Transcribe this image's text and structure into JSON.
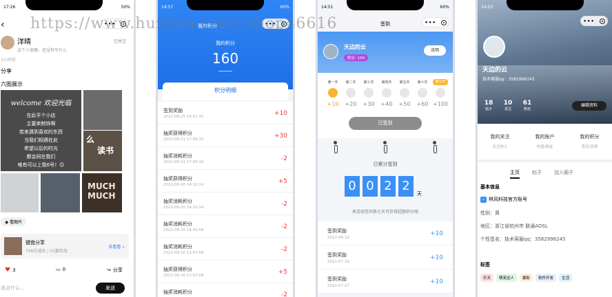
{
  "watermark": "https://www.huzhan.com/ishop46616",
  "phone1": {
    "status_time": "17:26",
    "status_batt": "50%",
    "header_title": "帖子详情",
    "author": "洋晴",
    "signature": "这个人很懒，还没有写什么",
    "follow": "已关注",
    "time": "3小时前",
    "share_heading": "分享",
    "six_heading": "六图展示",
    "image_head": "welcome 欢迎光临",
    "image_lines": [
      "在此平个小店",
      "主要卖制饰啊",
      "若来遇到喜欢的东西",
      "当我们相遇在此",
      "希望以后的时光",
      "都会同在我们",
      "唯有可以上我6号！☺"
    ],
    "image_r2": [
      "么",
      "读书"
    ],
    "image_b3": "MUCH MUCH",
    "pill": "看图片",
    "card_title": "键盘分享",
    "card_sub": "746位成员 / 31篇作品",
    "card_link": "去看看 »",
    "likes": "3",
    "comments": "0",
    "share": "分享",
    "input_placeholder": "说点什么...",
    "send": "发送"
  },
  "phone2": {
    "status_time": "14:57",
    "status_batt": "60%",
    "header_title": "我的积分",
    "label": "我的积分",
    "value": "160",
    "tab": "积分明细",
    "rows": [
      {
        "name": "签到奖励",
        "date": "2022-08-25 14:51:31",
        "value": "+10"
      },
      {
        "name": "抽奖获得积分",
        "date": "2022-08-21 17:00:10",
        "value": "+30"
      },
      {
        "name": "抽奖消耗积分",
        "date": "2022-08-21 17:00:10",
        "value": "-2"
      },
      {
        "name": "抽奖获得积分",
        "date": "2022-08-20 14:10:14",
        "value": "+5"
      },
      {
        "name": "抽奖消耗积分",
        "date": "2022-08-20 14:10:14",
        "value": "-2"
      },
      {
        "name": "抽奖消耗积分",
        "date": "2022-08-20 14:09:58",
        "value": "-2"
      },
      {
        "name": "抽奖消耗积分",
        "date": "2022-08-16 12:47:58",
        "value": "-2"
      },
      {
        "name": "抽奖获得积分",
        "date": "2022-08-16 11:07:08",
        "value": "+5"
      },
      {
        "name": "抽奖消耗积分",
        "date": "",
        "value": "-2"
      }
    ]
  },
  "phone3": {
    "status_time": "14:51",
    "status_batt": "60%",
    "title": "签到",
    "name": "天边的云",
    "points": "积分: 150",
    "rule_button": "说明",
    "days": [
      "第一天",
      "第二天",
      "第三天",
      "第四天",
      "第五天",
      "第六天",
      ""
    ],
    "rewards": [
      "+10",
      "+20",
      "+30",
      "+40",
      "+50",
      "+60",
      "+100"
    ],
    "today_badge": "第七天",
    "signed_button": "已签到",
    "cumulative": "已累计签到",
    "digits": [
      "0",
      "0",
      "2",
      "2"
    ],
    "unit": "天",
    "hint": "再连续签到第七天可获得超额积分哦",
    "rows": [
      {
        "name": "签到奖励",
        "date": "2022-08-10",
        "value": "+10"
      },
      {
        "name": "签到奖励",
        "date": "2022-07-29",
        "value": "+10"
      },
      {
        "name": "签到奖励",
        "date": "2022-07-27",
        "value": "+10"
      }
    ]
  },
  "phone4": {
    "status_time": "14:53",
    "name": "天边的云",
    "tech_qq": "技术客服qq：3582996245",
    "stats": [
      {
        "num": "18",
        "label": "帖子"
      },
      {
        "num": "10",
        "label": "关注"
      },
      {
        "num": "61",
        "label": "粉丝"
      }
    ],
    "edit": "编辑资料",
    "cards": [
      {
        "title": "我的关注",
        "sub": "关注的人"
      },
      {
        "title": "我的账户",
        "sub": "充值/佣金"
      },
      {
        "title": "我的积分",
        "sub": "签到/消费"
      }
    ],
    "tabs": [
      "主页",
      "帖子",
      "加入圈子"
    ],
    "basic_heading": "基本信息",
    "verify": "林风科技官方账号",
    "gender": "性别：男",
    "region": "地区：浙江省杭州市 联通ADSL",
    "sign": "个性签名：技术客服qq：3582996245",
    "tags_heading": "标签",
    "tags": [
      "乐天",
      "萌宠达人",
      "摄影",
      "软件开发",
      "生活"
    ],
    "tag_colors": [
      "#fde2e2",
      "#e2f5e6",
      "#fdf0dc",
      "#e6f0fb",
      "#dff2fb"
    ]
  }
}
